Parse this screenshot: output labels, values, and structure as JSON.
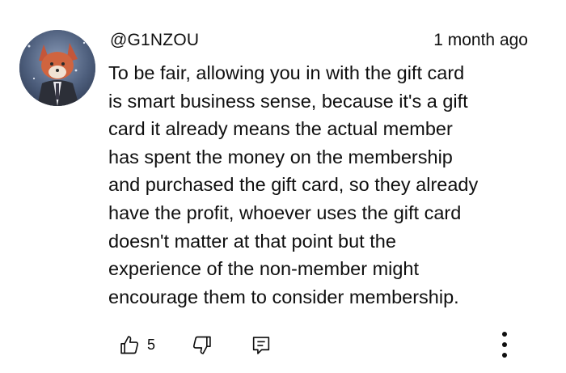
{
  "comment": {
    "author_handle": "@G1NZOU",
    "timestamp": "1 month ago",
    "text_lines": [
      "To be fair, allowing you in with the gift card",
      "is smart business sense, because it's a gift",
      "card it already means the actual member",
      "has spent the money on the membership",
      "and purchased the gift card, so they already",
      "have the profit, whoever uses the gift card",
      "doesn't matter at that point but the",
      "experience of the non-member might",
      "encourage them to consider membership."
    ],
    "like_count": "5"
  },
  "icons": {
    "avatar": "fox-character-avatar",
    "like": "thumbs-up-icon",
    "dislike": "thumbs-down-icon",
    "reply": "reply-comment-icon",
    "more": "more-vertical-icon"
  },
  "colors": {
    "text": "#0f0f0f",
    "background": "#ffffff",
    "icon": "#0f0f0f"
  }
}
